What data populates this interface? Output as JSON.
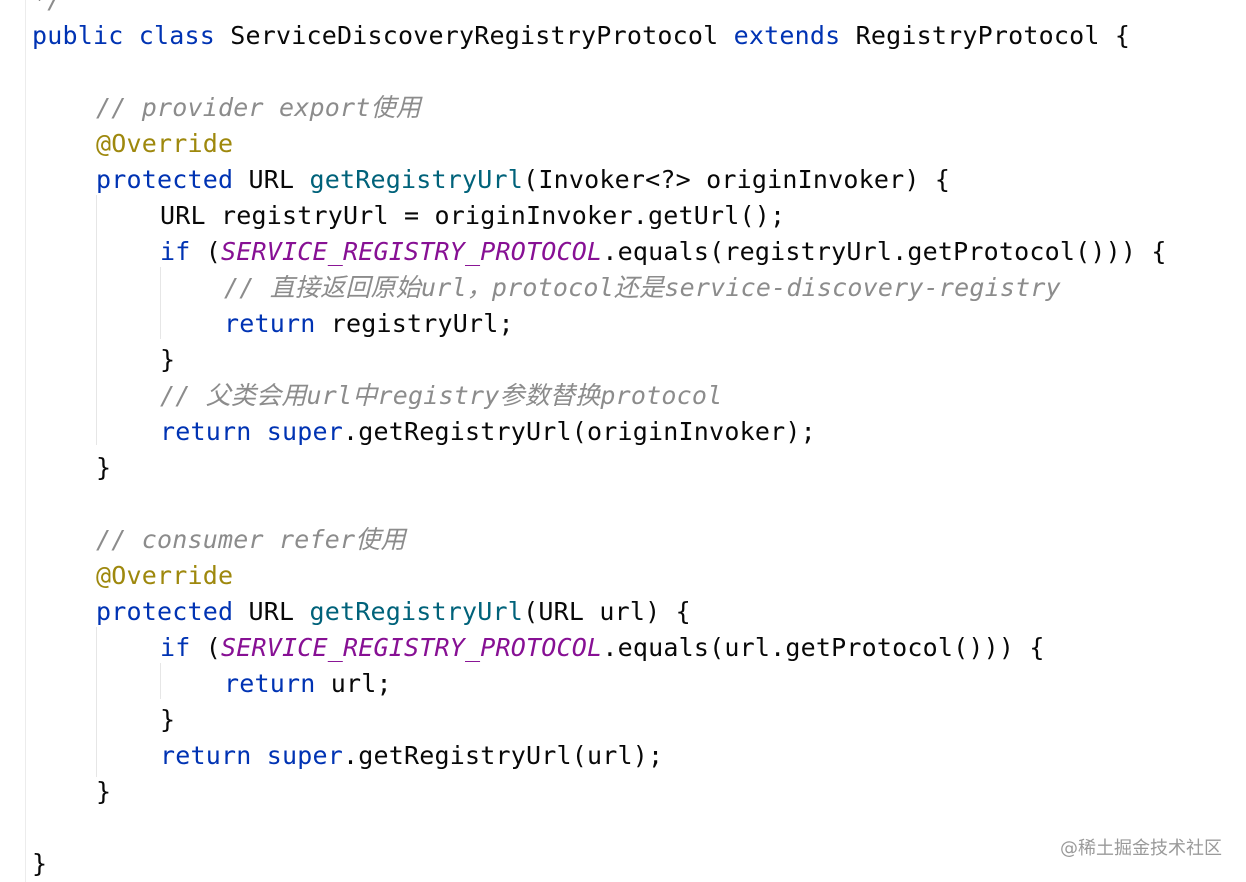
{
  "editor": {
    "lines": [
      {
        "indent": 0,
        "parts": [
          {
            "t": "*/",
            "c": "cm"
          }
        ]
      },
      {
        "indent": 0,
        "parts": [
          {
            "t": "public ",
            "c": "kw"
          },
          {
            "t": "class ",
            "c": "kw"
          },
          {
            "t": "ServiceDiscoveryRegistryProtocol ",
            "c": ""
          },
          {
            "t": "extends ",
            "c": "kw"
          },
          {
            "t": "RegistryProtocol {",
            "c": ""
          }
        ]
      },
      {
        "indent": 0,
        "parts": []
      },
      {
        "indent": 1,
        "parts": [
          {
            "t": "// provider export使用",
            "c": "cm"
          }
        ]
      },
      {
        "indent": 1,
        "parts": [
          {
            "t": "@Override",
            "c": "ann"
          }
        ]
      },
      {
        "indent": 1,
        "parts": [
          {
            "t": "protected ",
            "c": "kw"
          },
          {
            "t": "URL ",
            "c": ""
          },
          {
            "t": "getRegistryUrl",
            "c": "fn"
          },
          {
            "t": "(Invoker<?> originInvoker) {",
            "c": ""
          }
        ]
      },
      {
        "indent": 2,
        "parts": [
          {
            "t": "URL registryUrl = originInvoker.getUrl();",
            "c": ""
          }
        ]
      },
      {
        "indent": 2,
        "parts": [
          {
            "t": "if ",
            "c": "kw"
          },
          {
            "t": "(",
            "c": ""
          },
          {
            "t": "SERVICE_REGISTRY_PROTOCOL",
            "c": "cst"
          },
          {
            "t": ".equals(registryUrl.getProtocol())) {",
            "c": ""
          }
        ]
      },
      {
        "indent": 3,
        "parts": [
          {
            "t": "// 直接返回原始url，protocol还是service-discovery-registry",
            "c": "cm"
          }
        ]
      },
      {
        "indent": 3,
        "parts": [
          {
            "t": "return ",
            "c": "kw"
          },
          {
            "t": "registryUrl;",
            "c": ""
          }
        ]
      },
      {
        "indent": 2,
        "parts": [
          {
            "t": "}",
            "c": ""
          }
        ]
      },
      {
        "indent": 2,
        "parts": [
          {
            "t": "// 父类会用url中registry参数替换protocol",
            "c": "cm"
          }
        ]
      },
      {
        "indent": 2,
        "parts": [
          {
            "t": "return ",
            "c": "kw"
          },
          {
            "t": "super",
            "c": "kw"
          },
          {
            "t": ".getRegistryUrl(originInvoker);",
            "c": ""
          }
        ]
      },
      {
        "indent": 1,
        "parts": [
          {
            "t": "}",
            "c": ""
          }
        ]
      },
      {
        "indent": 0,
        "parts": []
      },
      {
        "indent": 1,
        "parts": [
          {
            "t": "// consumer refer使用",
            "c": "cm"
          }
        ]
      },
      {
        "indent": 1,
        "parts": [
          {
            "t": "@Override",
            "c": "ann"
          }
        ]
      },
      {
        "indent": 1,
        "parts": [
          {
            "t": "protected ",
            "c": "kw"
          },
          {
            "t": "URL ",
            "c": ""
          },
          {
            "t": "getRegistryUrl",
            "c": "fn"
          },
          {
            "t": "(URL url) {",
            "c": ""
          }
        ]
      },
      {
        "indent": 2,
        "parts": [
          {
            "t": "if ",
            "c": "kw"
          },
          {
            "t": "(",
            "c": ""
          },
          {
            "t": "SERVICE_REGISTRY_PROTOCOL",
            "c": "cst"
          },
          {
            "t": ".equals(url.getProtocol())) {",
            "c": ""
          }
        ]
      },
      {
        "indent": 3,
        "parts": [
          {
            "t": "return ",
            "c": "kw"
          },
          {
            "t": "url;",
            "c": ""
          }
        ]
      },
      {
        "indent": 2,
        "parts": [
          {
            "t": "}",
            "c": ""
          }
        ]
      },
      {
        "indent": 2,
        "parts": [
          {
            "t": "return ",
            "c": "kw"
          },
          {
            "t": "super",
            "c": "kw"
          },
          {
            "t": ".getRegistryUrl(url);",
            "c": ""
          }
        ]
      },
      {
        "indent": 1,
        "parts": [
          {
            "t": "}",
            "c": ""
          }
        ]
      },
      {
        "indent": 0,
        "parts": []
      },
      {
        "indent": 0,
        "parts": [
          {
            "t": "}",
            "c": ""
          }
        ]
      }
    ]
  },
  "watermark": "@稀土掘金技术社区",
  "colors": {
    "keyword": "#0033b3",
    "function": "#00627a",
    "annotation": "#9e880d",
    "constant": "#871094",
    "comment": "#8c8c8c",
    "text": "#080808",
    "background": "#ffffff"
  }
}
